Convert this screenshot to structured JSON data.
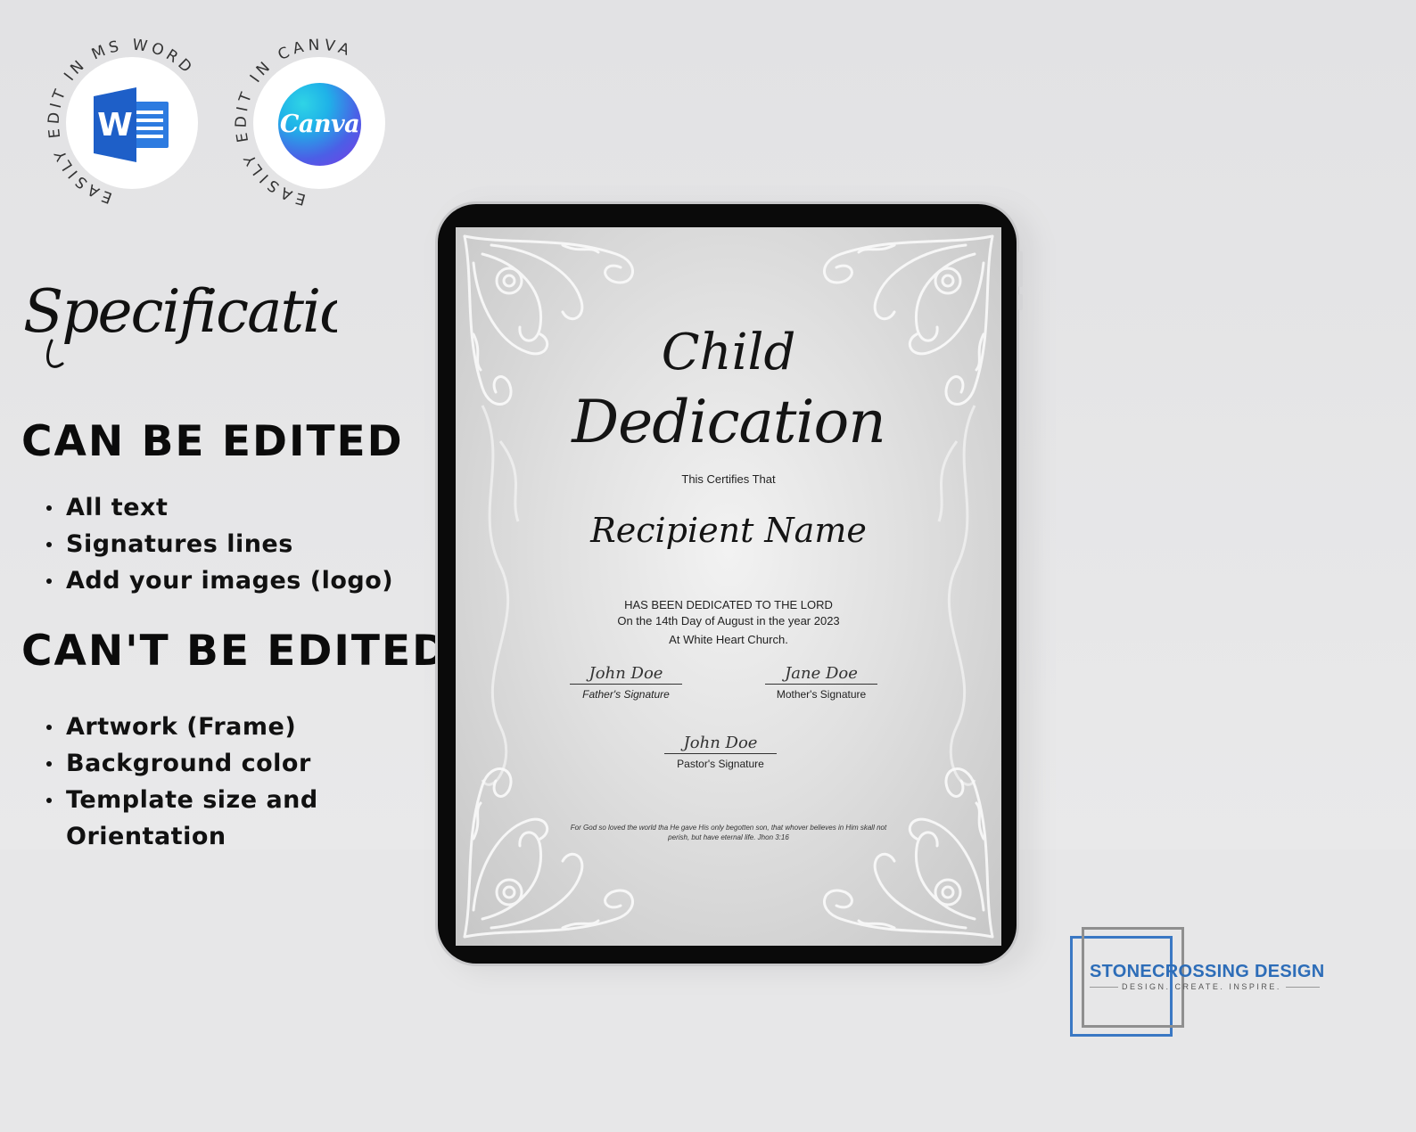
{
  "badges": {
    "word": {
      "ring_text": "EASILY EDIT IN MS WORD",
      "icon": "word-icon",
      "icon_letter": "W"
    },
    "canva": {
      "ring_text": "EASILY EDIT IN CANVA",
      "icon": "canva-icon",
      "icon_text": "Canva"
    }
  },
  "specification": {
    "title": "Specification",
    "can_heading": "CAN BE EDITED",
    "can_items": [
      "All text",
      "Signatures lines",
      "Add your images (logo)"
    ],
    "cant_heading": "CAN'T BE EDITED",
    "cant_items": [
      "Artwork (Frame)",
      "Background color",
      "Template size and",
      "Orientation"
    ]
  },
  "certificate": {
    "title_line1": "Child",
    "title_line2": "Dedication",
    "certifies": "This Certifies That",
    "recipient": "Recipient Name",
    "line1": "HAS BEEN DEDICATED TO THE LORD",
    "line2": "On the 14th Day of August in the year 2023",
    "line3": "At White Heart Church.",
    "father_sig_name": "John Doe",
    "father_sig_label": "Father's Signature",
    "mother_sig_name": "Jane Doe",
    "mother_sig_label": "Mother's Signature",
    "pastor_sig_name": "John Doe",
    "pastor_sig_label": "Pastor's Signature",
    "verse": "For God so loved the world tha He gave His only begotten son, that whover believes in Him skall not perish, but have eternal life. Jhon 3:16"
  },
  "logo": {
    "brand": "STONECROSSING DESIGN",
    "tagline": "DESIGN. CREATE. INSPIRE."
  },
  "colors": {
    "background": "#e6e6e7",
    "heading": "#0b0b0b",
    "brand_blue": "#2d6db8",
    "word_blue": "#1e5fc8"
  }
}
